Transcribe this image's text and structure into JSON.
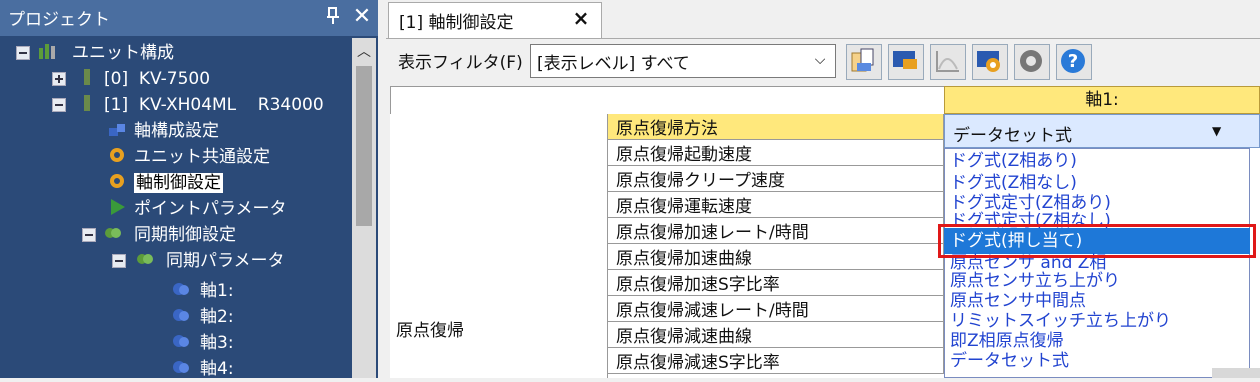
{
  "project": {
    "title": "プロジェクト",
    "pin_icon": "pin-icon",
    "close_icon": "close-icon",
    "tree": [
      {
        "label": "ユニット構成",
        "icon": "unit-config-icon"
      },
      {
        "label": "[0]  KV-7500",
        "icon": "cpu-unit-icon"
      },
      {
        "label": "[1]  KV-XH04ML    R34000",
        "icon": "motion-unit-icon"
      },
      {
        "label": "軸構成設定",
        "icon": "axis-config-icon"
      },
      {
        "label": "ユニット共通設定",
        "icon": "gear-icon"
      },
      {
        "label": "軸制御設定",
        "icon": "gear-icon"
      },
      {
        "label": "ポイントパラメータ",
        "icon": "flag-icon"
      },
      {
        "label": "同期制御設定",
        "icon": "sync-icon"
      },
      {
        "label": "同期パラメータ",
        "icon": "sync-param-icon"
      },
      {
        "label": "軸1:",
        "icon": "axis-icon"
      },
      {
        "label": "軸2:",
        "icon": "axis-icon"
      },
      {
        "label": "軸3:",
        "icon": "axis-icon"
      },
      {
        "label": "軸4:",
        "icon": "axis-icon"
      }
    ]
  },
  "tab": {
    "label": "[1] 軸制御設定",
    "close": "×"
  },
  "filter": {
    "label": "表示フィルタ(F)",
    "value": "[表示レベル] すべて"
  },
  "toolbar": [
    "import-icon",
    "monitor-icon",
    "graph-icon",
    "settings-window-icon",
    "gear-icon",
    "help-icon"
  ],
  "grid": {
    "axis_header": "軸1:",
    "group_label": "原点復帰",
    "selected_value": "データセット式",
    "rows": [
      "原点復帰方法",
      "原点復帰起動速度",
      "原点復帰クリープ速度",
      "原点復帰運転速度",
      "原点復帰加速レート/時間",
      "原点復帰加速曲線",
      "原点復帰加速S字比率",
      "原点復帰減速レート/時間",
      "原点復帰減速曲線",
      "原点復帰減速S字比率"
    ]
  },
  "dropdown": {
    "options": [
      "ドグ式(Z相あり)",
      "ドグ式(Z相なし)",
      "ドグ式定寸(Z相あり)",
      "ドグ式定寸(Z相なし)",
      "ドグ式(押し当て)",
      "原点センサ and Z相",
      "原点センサ立ち上がり",
      "原点センサ中間点",
      "リミットスイッチ立ち上がり",
      "即Z相原点復帰",
      "データセット式"
    ],
    "highlighted": "ドグ式(押し当て)"
  }
}
